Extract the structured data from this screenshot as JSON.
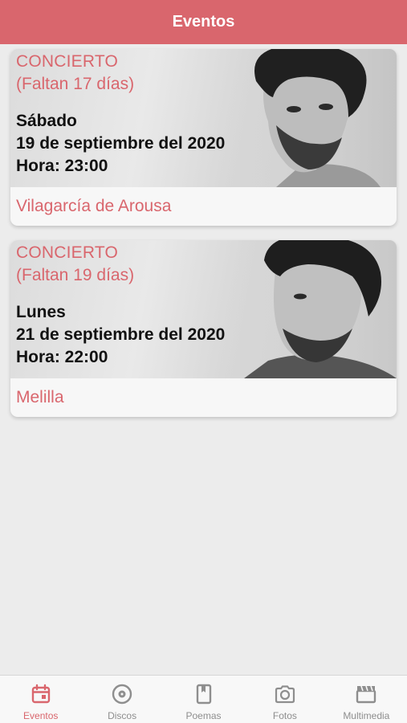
{
  "header": {
    "title": "Eventos"
  },
  "events": [
    {
      "kind": "CONCIERTO",
      "countdown": "(Faltan 17 días)",
      "day": "Sábado",
      "date": "19 de septiembre del 2020",
      "time": "Hora: 23:00",
      "place": "Vilagarcía de Arousa"
    },
    {
      "kind": "CONCIERTO",
      "countdown": "(Faltan 19 días)",
      "day": "Lunes",
      "date": "21 de septiembre del 2020",
      "time": "Hora: 22:00",
      "place": "Melilla"
    }
  ],
  "tabs": [
    {
      "label": "Eventos",
      "icon": "calendar-icon",
      "active": true
    },
    {
      "label": "Discos",
      "icon": "disc-icon",
      "active": false
    },
    {
      "label": "Poemas",
      "icon": "book-icon",
      "active": false
    },
    {
      "label": "Fotos",
      "icon": "camera-icon",
      "active": false
    },
    {
      "label": "Multimedia",
      "icon": "clapperboard-icon",
      "active": false
    }
  ],
  "colors": {
    "accent": "#d9666d",
    "background": "#ececec",
    "inactive": "#8e8e8e"
  }
}
